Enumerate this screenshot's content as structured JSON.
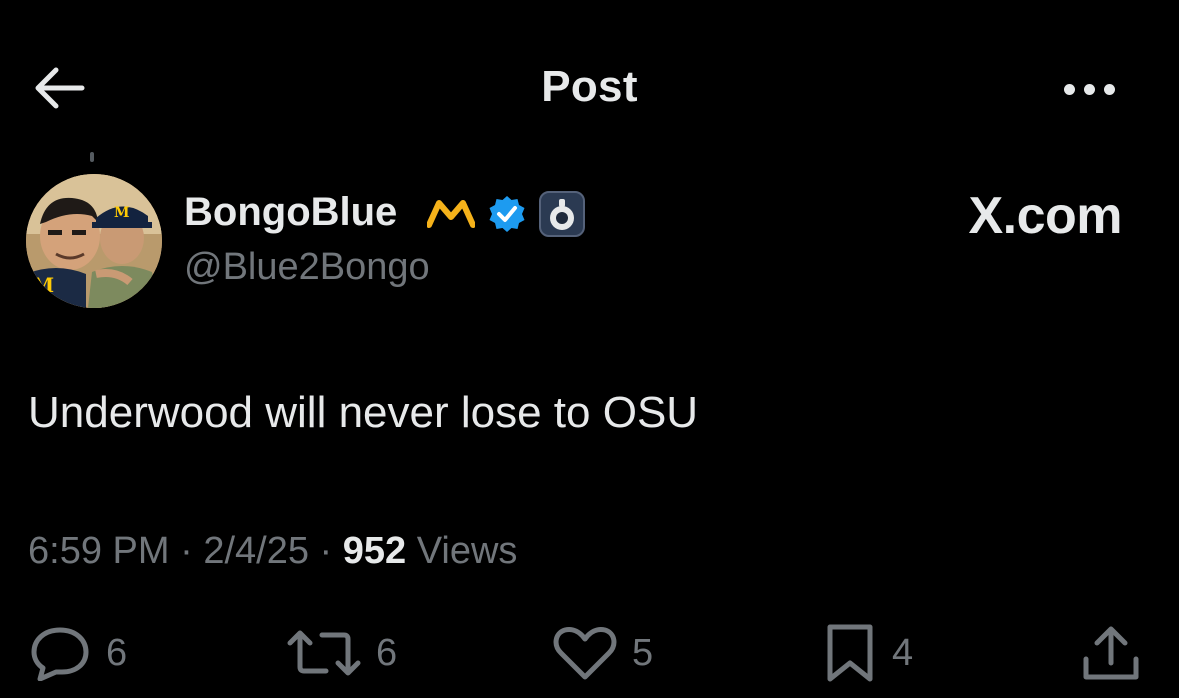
{
  "header": {
    "title": "Post",
    "back_icon": "arrow-left-icon",
    "more_icon": "more-horizontal-icon"
  },
  "author": {
    "display_name": "BongoBlue",
    "handle": "@Blue2Bongo",
    "badges": [
      "michigan-m-icon",
      "verified-check-icon",
      "grok-app-icon"
    ]
  },
  "source_label": "X.com",
  "post": {
    "text": "Underwood will never lose to OSU"
  },
  "meta": {
    "time": "6:59 PM",
    "separator": "·",
    "date": "2/4/25",
    "views_count": "952",
    "views_label": "Views"
  },
  "actions": {
    "replies": "6",
    "reposts": "6",
    "likes": "5",
    "bookmarks": "4"
  },
  "colors": {
    "background": "#000000",
    "text_primary": "#e7e9ea",
    "text_secondary": "#71767b",
    "verified_blue": "#1d9bf0",
    "michigan_maize": "#ffcb05"
  }
}
